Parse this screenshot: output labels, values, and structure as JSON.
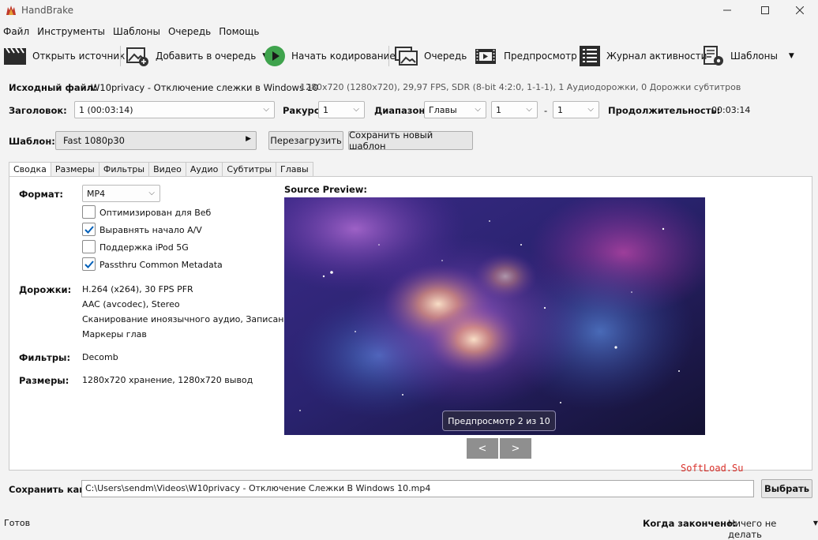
{
  "window": {
    "title": "HandBrake"
  },
  "menu": [
    "Файл",
    "Инструменты",
    "Шаблоны",
    "Очередь",
    "Помощь"
  ],
  "toolbar": {
    "open_source": "Открыть источник",
    "add_to_queue": "Добавить в очередь",
    "start_encode": "Начать кодирование",
    "queue": "Очередь",
    "preview": "Предпросмотр",
    "activity_log": "Журнал активности",
    "presets": "Шаблоны"
  },
  "source": {
    "label": "Исходный файл:",
    "name": "W10privacy - Отключение слежки в Windows 10",
    "info": "1280x720 (1280x720), 29,97 FPS, SDR (8-bit 4:2:0, 1-1-1), 1 Аудиодорожки, 0 Дорожки субтитров"
  },
  "title_row": {
    "title_label": "Заголовок:",
    "title_value": "1  (00:03:14)",
    "angle_label": "Ракурс:",
    "angle_value": "1",
    "range_label": "Диапазон:",
    "range_type": "Главы",
    "range_from": "1",
    "range_dash": "-",
    "range_to": "1",
    "duration_label": "Продолжительность:",
    "duration_value": "00:03:14"
  },
  "preset_row": {
    "label": "Шаблон:",
    "value": "Fast 1080p30",
    "reload": "Перезагрузить",
    "save_new": "Сохранить новый шаблон"
  },
  "tabs": [
    "Сводка",
    "Размеры",
    "Фильтры",
    "Видео",
    "Аудио",
    "Субтитры",
    "Главы"
  ],
  "summary": {
    "format_label": "Формат:",
    "format_value": "MP4",
    "checkboxes": [
      {
        "label": "Оптимизирован для Веб",
        "checked": false
      },
      {
        "label": "Выравнять начало A/V",
        "checked": true
      },
      {
        "label": "Поддержка iPod 5G",
        "checked": false
      },
      {
        "label": "Passthru Common Metadata",
        "checked": true
      }
    ],
    "tracks_label": "Дорожки:",
    "tracks": [
      "H.264 (x264), 30 FPS PFR",
      "AAC (avcodec), Stereo",
      "Сканирование иноязычного аудио, Записано",
      "Маркеры глав"
    ],
    "filters_label": "Фильтры:",
    "filters_value": "Decomb",
    "sizes_label": "Размеры:",
    "sizes_value": "1280x720 хранение, 1280x720 вывод"
  },
  "preview": {
    "heading": "Source Preview:",
    "badge": "Предпросмотр 2 из 10",
    "prev": "<",
    "next": ">"
  },
  "watermark": "SoftLoad.Su",
  "save_as": {
    "label": "Сохранить как:",
    "path": "C:\\Users\\sendm\\Videos\\W10privacy - Отключение Слежки В Windows 10.mp4",
    "browse": "Выбрать"
  },
  "status": {
    "text": "Готов",
    "when_done_label": "Когда закончено:",
    "when_done_value": "Ничего не делать"
  },
  "colors": {
    "accent_check": "#005fb8",
    "start_green": "#3fa34d",
    "preview_badge_bg": "#2a2746"
  }
}
